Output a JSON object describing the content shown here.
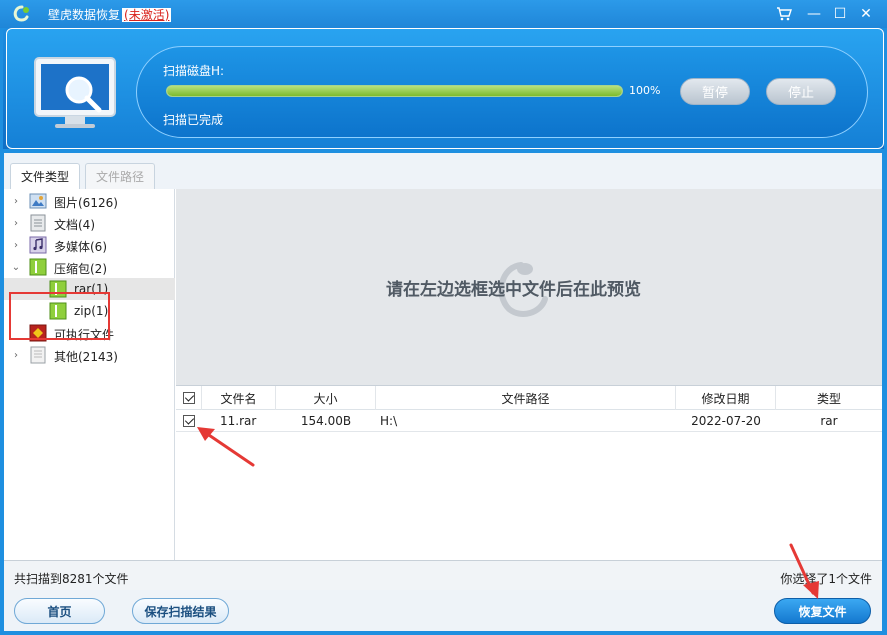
{
  "app": {
    "title": "壁虎数据恢复",
    "activation_status": "(未激活)"
  },
  "window_controls": {
    "cart_icon": "cart-icon",
    "minimize_glyph": "—",
    "maximize_glyph": "☐",
    "close_glyph": "✕"
  },
  "scan": {
    "label": "扫描磁盘H:",
    "progress_percent": 100,
    "progress_text": "100%",
    "status": "扫描已完成",
    "pause_label": "暂停",
    "stop_label": "停止"
  },
  "tabs": [
    {
      "label": "文件类型",
      "active": true
    },
    {
      "label": "文件路径",
      "active": false
    }
  ],
  "tree": {
    "items": [
      {
        "label": "图片(6126)",
        "icon": "image-icon",
        "expander": "›"
      },
      {
        "label": "文档(4)",
        "icon": "document-icon",
        "expander": "›"
      },
      {
        "label": "多媒体(6)",
        "icon": "media-icon",
        "expander": "›"
      },
      {
        "label": "压缩包(2)",
        "icon": "archive-icon",
        "expander": "⌄"
      },
      {
        "label": "rar(1)",
        "icon": "archive-icon",
        "expander": ""
      },
      {
        "label": "zip(1)",
        "icon": "archive-icon",
        "expander": ""
      },
      {
        "label": "可执行文件",
        "icon": "executable-icon",
        "expander": ""
      },
      {
        "label": "其他(2143)",
        "icon": "other-file-icon",
        "expander": "›"
      }
    ]
  },
  "preview": {
    "placeholder": "请在左边选框选中文件后在此预览"
  },
  "grid": {
    "columns": [
      "文件名",
      "大小",
      "文件路径",
      "修改日期",
      "类型"
    ],
    "rows": [
      {
        "name": "11.rar",
        "size": "154.00B",
        "path": "H:\\",
        "date": "2022-07-20",
        "type": "rar",
        "checked": true
      }
    ]
  },
  "status": {
    "left": "共扫描到8281个文件",
    "right": "你选择了1个文件"
  },
  "buttons": {
    "home": "首页",
    "save_results": "保存扫描结果",
    "recover": "恢复文件"
  },
  "colors": {
    "title_bar": "#1f86d8",
    "progress": "#7dbb2d",
    "annotation": "#e53935",
    "activation": "#d9231c"
  }
}
